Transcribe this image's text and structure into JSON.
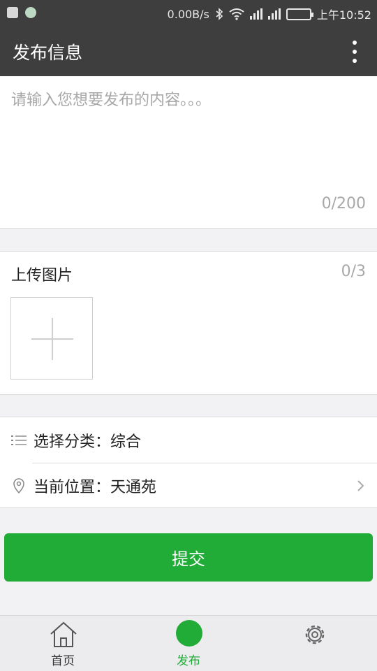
{
  "status_bar": {
    "net_speed": "0.00B/s",
    "time": "上午10:52",
    "icons": [
      "notification-icon",
      "app-icon",
      "bluetooth-icon",
      "wifi-icon",
      "signal-icon",
      "battery-icon"
    ]
  },
  "app_bar": {
    "title": "发布信息",
    "menu_icon": "overflow-menu-icon"
  },
  "content": {
    "placeholder": "请输入您想要发布的内容。。。",
    "value": "",
    "counter": "0/200"
  },
  "upload": {
    "label": "上传图片",
    "count": "0/3",
    "add_icon": "plus-icon"
  },
  "category": {
    "label": "选择分类：综合",
    "icon": "list-icon"
  },
  "location": {
    "label": "当前位置：天通苑",
    "icon": "location-pin-icon",
    "chevron": "chevron-right-icon"
  },
  "submit": {
    "label": "提交"
  },
  "tabbar": {
    "tabs": [
      {
        "label": "首页",
        "icon": "home-icon"
      },
      {
        "label": "发布",
        "icon": "publish-icon",
        "active": true
      },
      {
        "label": "",
        "icon": "gear-icon"
      }
    ]
  },
  "colors": {
    "accent": "#21ac38",
    "header": "#3e3e3e",
    "background": "#f2f2f4"
  }
}
